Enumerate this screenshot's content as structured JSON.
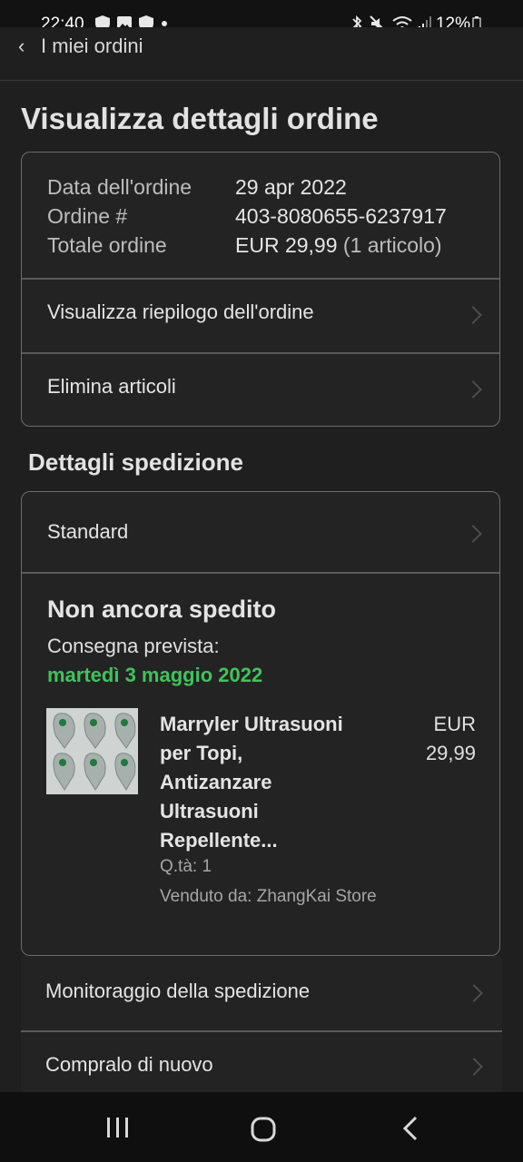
{
  "status_bar": {
    "time": "22:40",
    "battery": "12%"
  },
  "topnav": {
    "back_label": "I miei ordini"
  },
  "page": {
    "title": "Visualizza dettagli ordine"
  },
  "order": {
    "date_label": "Data dell'ordine",
    "date_value": "29 apr 2022",
    "number_label": "Ordine #",
    "number_value": "403-8080655-6237917",
    "total_label": "Totale ordine",
    "total_value": "EUR 29,99",
    "total_items": "(1 articolo)",
    "summary_link": "Visualizza riepilogo dell'ordine",
    "delete_link": "Elimina articoli"
  },
  "shipping": {
    "section_title": "Dettagli spedizione",
    "method": "Standard",
    "status": "Non ancora spedito",
    "delivery_label": "Consegna prevista:",
    "delivery_date": "martedì 3 maggio 2022",
    "item": {
      "title_lines": [
        "Marryler Ultrasuoni",
        "per Topi,",
        "Antizanzare",
        "Ultrasuoni",
        "Repellente..."
      ],
      "price_currency": "EUR",
      "price_amount": "29,99",
      "quantity": "Q.tà: 1",
      "seller": "Venduto da: ZhangKai Store"
    }
  },
  "actions": {
    "track": "Monitoraggio della spedizione",
    "buy_again": "Compralo di nuovo"
  },
  "colors": {
    "accent_green": "#3ec45a",
    "background": "#1f1f1f"
  }
}
